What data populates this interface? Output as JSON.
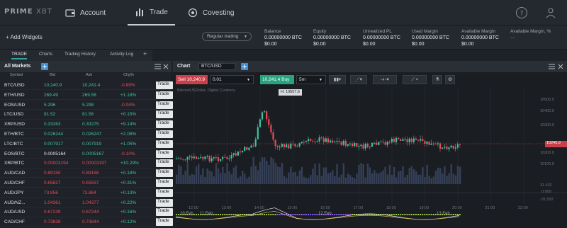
{
  "app": {
    "logo_bold": "PRIME",
    "logo_thin": "XBT"
  },
  "nav": {
    "account": "Account",
    "trade": "Trade",
    "covesting": "Covesting"
  },
  "subbar": {
    "add_widgets": "+ Add Widgets",
    "trading_mode": "Regular trading",
    "stats": [
      {
        "label": "Balance",
        "value": "0.00000000 BTC",
        "usd": "$0.00"
      },
      {
        "label": "Equity",
        "value": "0.00000000 BTC",
        "usd": "$0.00"
      },
      {
        "label": "Unrealized PL",
        "value": "0.00000000 BTC",
        "usd": "$0.00"
      },
      {
        "label": "Used Margin",
        "value": "0.00000000 BTC",
        "usd": "$0.00"
      },
      {
        "label": "Available Margin",
        "value": "0.00000000 BTC",
        "usd": "$0.00"
      },
      {
        "label": "Available Margin, %",
        "value": "—"
      }
    ]
  },
  "tabs": [
    "TRADE",
    "Charts",
    "Trading History",
    "Activity Log",
    "+"
  ],
  "markets": {
    "title": "All Markets",
    "columns": [
      "Symbol",
      "Bid",
      "Ask",
      "Chg%"
    ],
    "trade_label": "Trade",
    "rows": [
      {
        "symbol": "BTC/USD",
        "bid": "10,240.9",
        "ask": "10,241.4",
        "chg": "-0.89%",
        "bid_c": "g",
        "ask_c": "g",
        "chg_c": "r"
      },
      {
        "symbol": "ETH/USD",
        "bid": "269.49",
        "ask": "269.58",
        "chg": "+1.18%",
        "bid_c": "g",
        "ask_c": "g",
        "chg_c": "g"
      },
      {
        "symbol": "EOS/USD",
        "bid": "5.296",
        "ask": "5.298",
        "chg": "-0.04%",
        "bid_c": "g",
        "ask_c": "g",
        "chg_c": "r"
      },
      {
        "symbol": "LTC/USD",
        "bid": "81.52",
        "ask": "81.56",
        "chg": "+0.15%",
        "bid_c": "g",
        "ask_c": "g",
        "chg_c": "g"
      },
      {
        "symbol": "XRP/USD",
        "bid": "0.33263",
        "ask": "0.33275",
        "chg": "+9.14%",
        "bid_c": "g",
        "ask_c": "g",
        "chg_c": "g"
      },
      {
        "symbol": "ETH/BTC",
        "bid": "0.026244",
        "ask": "0.026247",
        "chg": "+2.08%",
        "bid_c": "g",
        "ask_c": "g",
        "chg_c": "g"
      },
      {
        "symbol": "LTC/BTC",
        "bid": "0.007917",
        "ask": "0.007919",
        "chg": "+1.05%",
        "bid_c": "g",
        "ask_c": "g",
        "chg_c": "g"
      },
      {
        "symbol": "EOS/BTC",
        "bid": "0.0005164",
        "ask": "0.0005167",
        "chg": "-0.10%",
        "bid_c": "w",
        "ask_c": "g",
        "chg_c": "r"
      },
      {
        "symbol": "XRP/BTC",
        "bid": "0.00003194",
        "ask": "0.00003197",
        "chg": "+10.29%",
        "bid_c": "r",
        "ask_c": "r",
        "chg_c": "g"
      },
      {
        "symbol": "AUD/CAD",
        "bid": "0.89150",
        "ask": "0.89158",
        "chg": "+0.18%",
        "bid_c": "r",
        "ask_c": "r",
        "chg_c": "g"
      },
      {
        "symbol": "AUD/CHF",
        "bid": "0.65827",
        "ask": "0.65837",
        "chg": "+0.31%",
        "bid_c": "r",
        "ask_c": "r",
        "chg_c": "g"
      },
      {
        "symbol": "AUD/JPY",
        "bid": "73.856",
        "ask": "73.864",
        "chg": "+0.13%",
        "bid_c": "r",
        "ask_c": "r",
        "chg_c": "g"
      },
      {
        "symbol": "AUD/NZ...",
        "bid": "1.04361",
        "ask": "1.04377",
        "chg": "+0.22%",
        "bid_c": "r",
        "ask_c": "r",
        "chg_c": "g"
      },
      {
        "symbol": "AUD/USD",
        "bid": "0.67239",
        "ask": "0.67244",
        "chg": "+0.16%",
        "bid_c": "r",
        "ask_c": "r",
        "chg_c": "g"
      },
      {
        "symbol": "CAD/CHF",
        "bid": "0.73838",
        "ask": "0.73844",
        "chg": "+0.12%",
        "bid_c": "r",
        "ask_c": "r",
        "chg_c": "g"
      }
    ]
  },
  "chart": {
    "title": "Chart",
    "symbol": "BTC/USD",
    "sell_label": "Sell 10,240.9",
    "buy_label": "10,241.4 Buy",
    "quantity": "0.01",
    "interval": "5m",
    "info": "Bitcoin/USDollar, Digital Currency",
    "high_marker": "H: 10507.6",
    "current_price": "10240.9",
    "price_labels": [
      "10500.0",
      "10400.0",
      "10300.0",
      "10200.0",
      "10100.0"
    ],
    "indicator_labels": [
      "31.532",
      "0.000",
      "-31.532"
    ],
    "time_labels": [
      "12:00",
      "13:00",
      "14:00",
      "15:00",
      "16:00",
      "17:00",
      "18:00",
      "19:00",
      "20:00",
      "21:00",
      "22:00"
    ],
    "date_labels": [
      "10 Feb",
      "11 Feb",
      "12 Feb",
      "13 Feb"
    ]
  },
  "colors": {
    "up": "#3ec29f",
    "down": "#e84b57",
    "accent": "#2fa7a0",
    "bg": "#1a1d22"
  }
}
